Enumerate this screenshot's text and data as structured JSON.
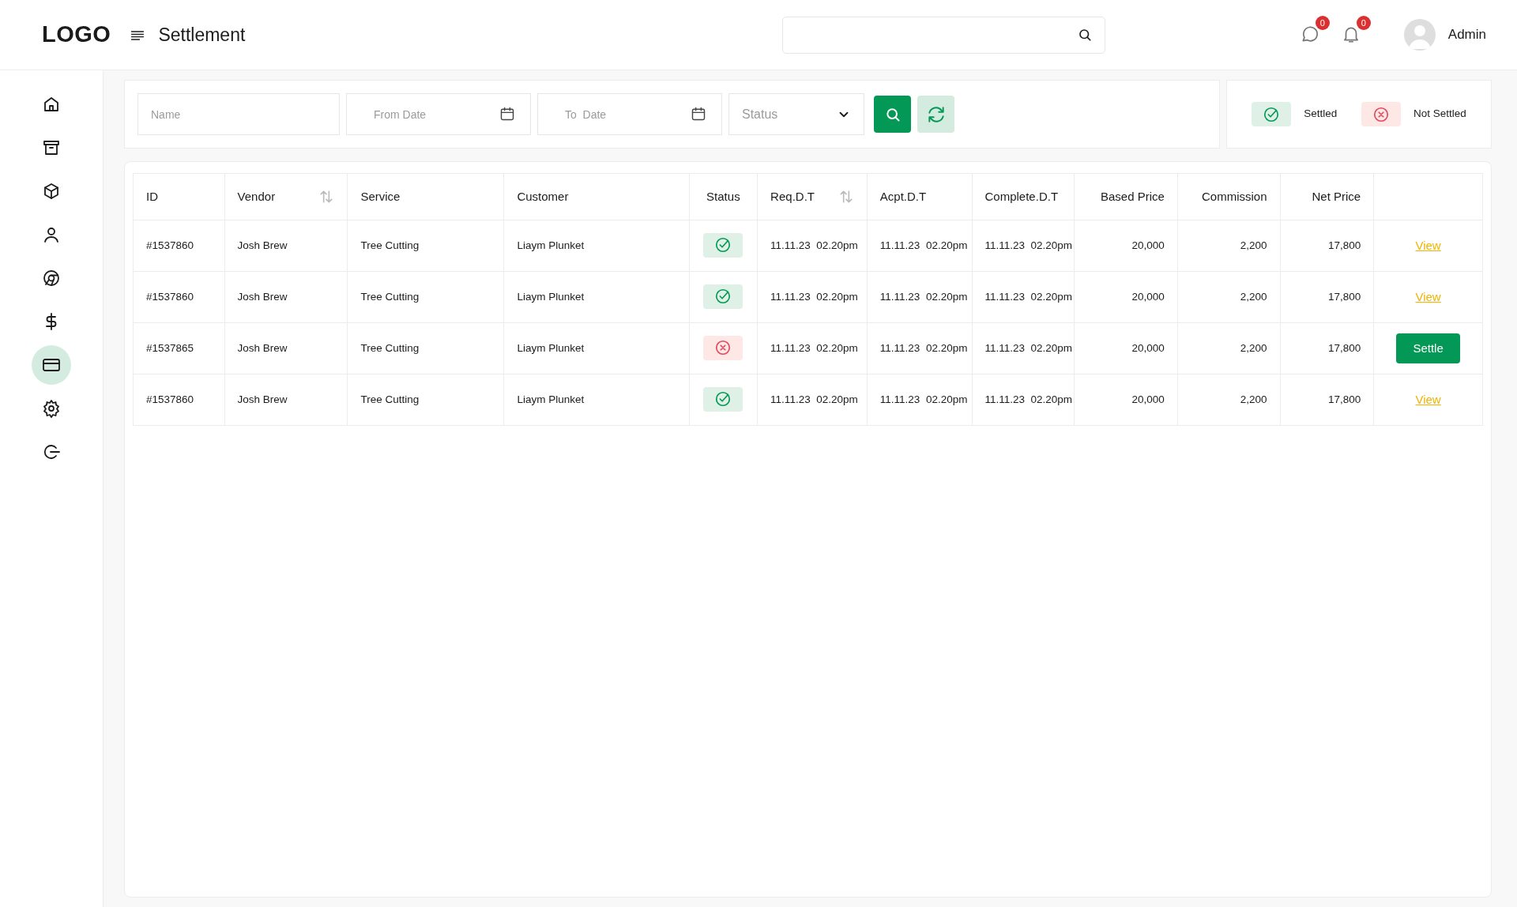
{
  "header": {
    "logo": "LOGO",
    "title": "Settlement",
    "notifications": [
      {
        "count": "0"
      },
      {
        "count": "0"
      }
    ],
    "user": "Admin"
  },
  "sidebar": {
    "items": [
      {
        "selected": false
      },
      {
        "selected": false
      },
      {
        "selected": false
      },
      {
        "selected": false
      },
      {
        "selected": false
      },
      {
        "selected": false
      },
      {
        "selected": true
      },
      {
        "selected": false
      },
      {
        "selected": false
      }
    ]
  },
  "filters": {
    "name": {
      "placeholder": "Name"
    },
    "from_date": {
      "placeholder": "From Date"
    },
    "to_date": {
      "placeholder": "To  Date"
    },
    "status": {
      "placeholder": "Status"
    }
  },
  "legend": [
    {
      "settled": true,
      "label": "Settled"
    },
    {
      "settled": false,
      "label": "Not Settled"
    }
  ],
  "table": {
    "columns": [
      {
        "label": "ID",
        "sortable": false
      },
      {
        "label": "Vendor",
        "sortable": true
      },
      {
        "label": "Service",
        "sortable": false
      },
      {
        "label": "Customer",
        "sortable": false
      },
      {
        "label": "Status",
        "sortable": false
      },
      {
        "label": "Req.D.T",
        "sortable": true
      },
      {
        "label": "Acpt.D.T",
        "sortable": false
      },
      {
        "label": "Complete.D.T",
        "sortable": false
      },
      {
        "label": "Based Price",
        "sortable": false
      },
      {
        "label": "Commission",
        "sortable": false
      },
      {
        "label": "Net Price",
        "sortable": false
      }
    ],
    "rows": [
      {
        "id": "#1537860",
        "vendor": "Josh Brew",
        "service": "Tree Cutting",
        "customer": "Liaym Plunket",
        "settled": true,
        "req": "11.11.23  02.20pm",
        "acpt": "11.11.23  02.20pm",
        "complete": "11.11.23  02.20pm",
        "based_price": "20,000",
        "commission": "2,200",
        "net_price": "17,800",
        "action": {
          "kind": "link",
          "label": "View"
        }
      },
      {
        "id": "#1537860",
        "vendor": "Josh Brew",
        "service": "Tree Cutting",
        "customer": "Liaym Plunket",
        "settled": true,
        "req": "11.11.23  02.20pm",
        "acpt": "11.11.23  02.20pm",
        "complete": "11.11.23  02.20pm",
        "based_price": "20,000",
        "commission": "2,200",
        "net_price": "17,800",
        "action": {
          "kind": "link",
          "label": "View"
        }
      },
      {
        "id": "#1537865",
        "vendor": "Josh Brew",
        "service": "Tree Cutting",
        "customer": "Liaym Plunket",
        "settled": false,
        "req": "11.11.23  02.20pm",
        "acpt": "11.11.23  02.20pm",
        "complete": "11.11.23  02.20pm",
        "based_price": "20,000",
        "commission": "2,200",
        "net_price": "17,800",
        "action": {
          "kind": "button",
          "label": "Settle"
        }
      },
      {
        "id": "#1537860",
        "vendor": "Josh Brew",
        "service": "Tree Cutting",
        "customer": "Liaym Plunket",
        "settled": true,
        "req": "11.11.23  02.20pm",
        "acpt": "11.11.23  02.20pm",
        "complete": "11.11.23  02.20pm",
        "based_price": "20,000",
        "commission": "2,200",
        "net_price": "17,800",
        "action": {
          "kind": "link",
          "label": "View"
        }
      }
    ]
  }
}
